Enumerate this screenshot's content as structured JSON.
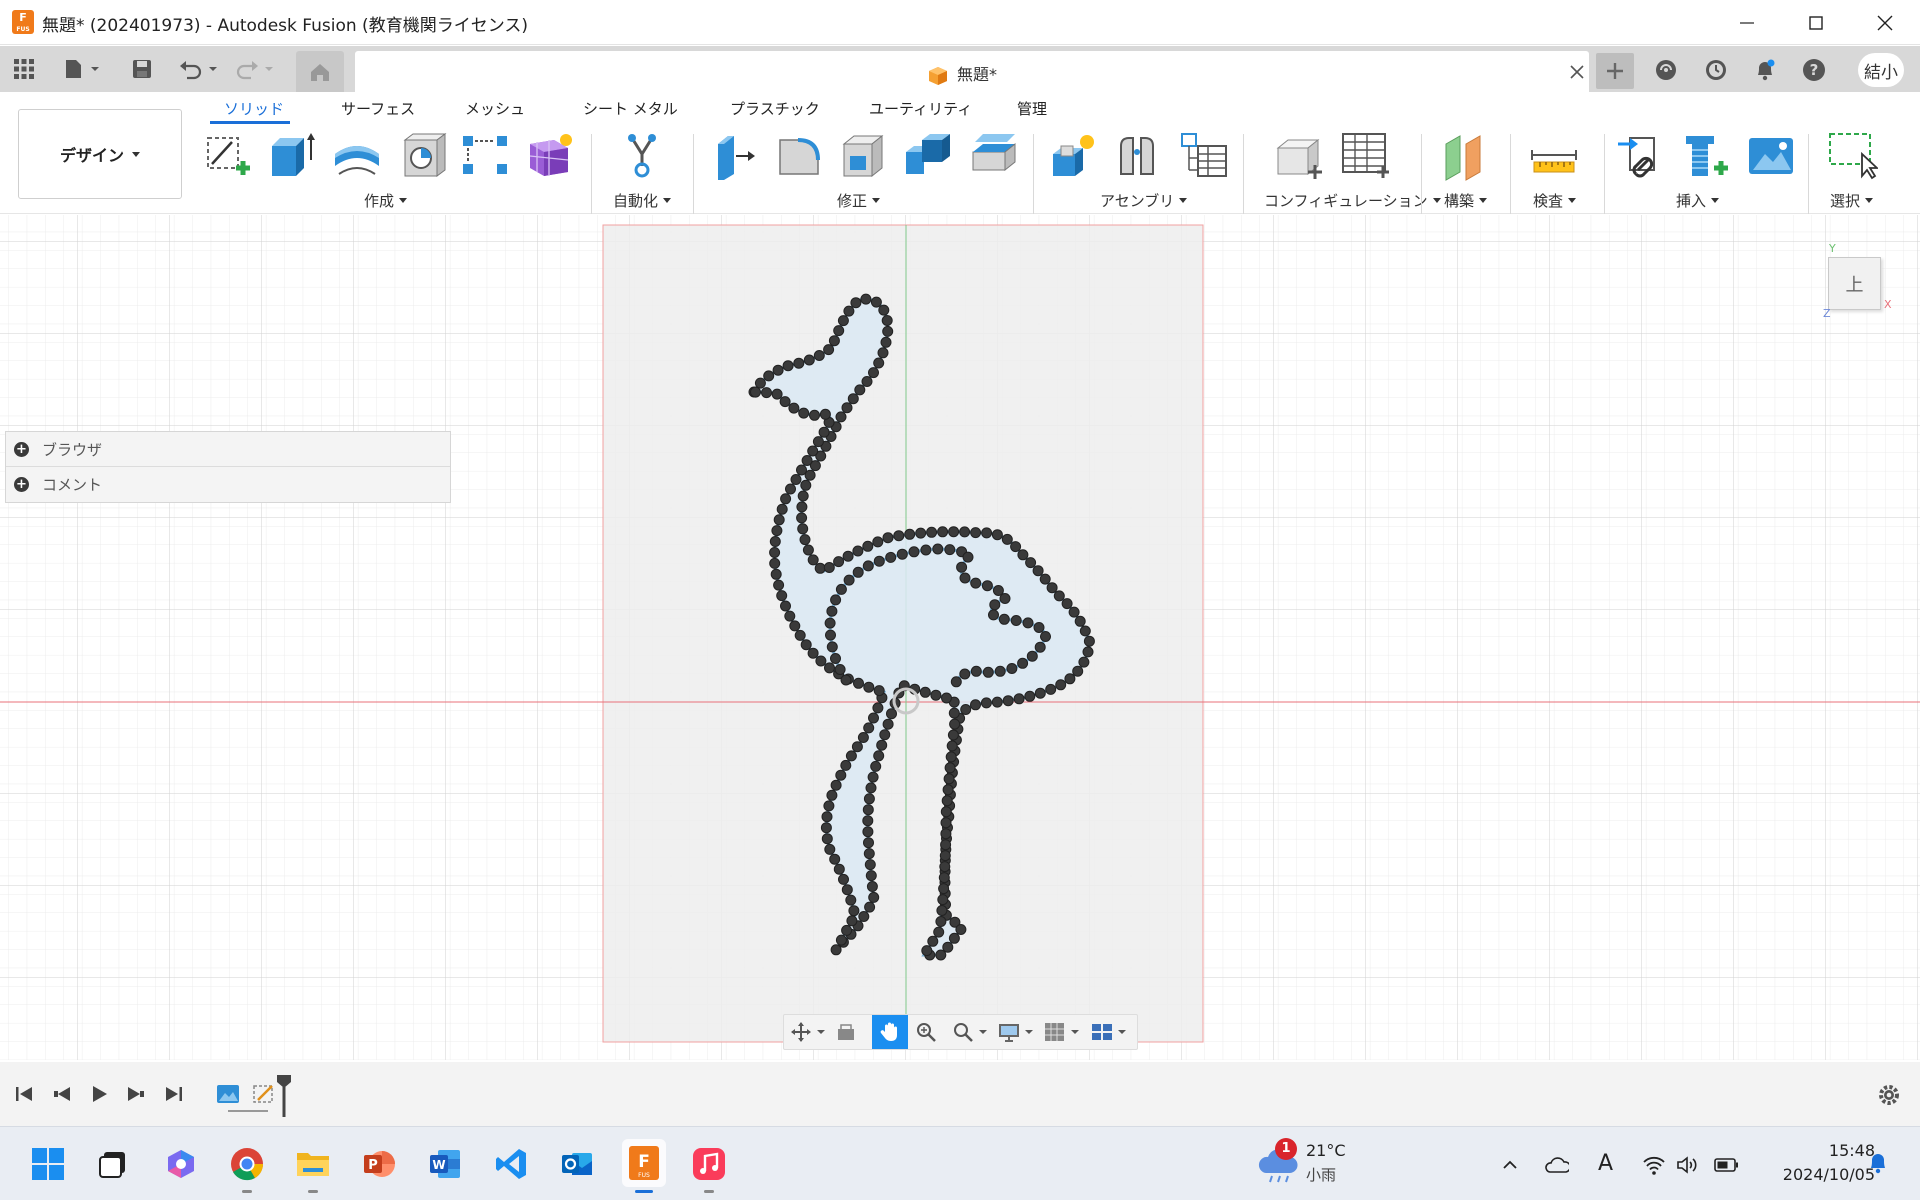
{
  "window": {
    "title": "無題* (202401973) - Autodesk Fusion (教育機関ライセンス)",
    "app_icon_text": "F",
    "app_icon_sub": "FUS"
  },
  "document": {
    "tab_label": "無題*"
  },
  "user": {
    "initials": "結小"
  },
  "workspace": {
    "label": "デザイン"
  },
  "tabs": [
    "ソリッド",
    "サーフェス",
    "メッシュ",
    "シート メタル",
    "プラスチック",
    "ユーティリティ",
    "管理"
  ],
  "active_tab": "ソリッド",
  "tool_groups": [
    {
      "label": "作成"
    },
    {
      "label": "自動化"
    },
    {
      "label": "修正"
    },
    {
      "label": "アセンブリ"
    },
    {
      "label": "コンフィギュレーション"
    },
    {
      "label": "構築"
    },
    {
      "label": "検査"
    },
    {
      "label": "挿入"
    },
    {
      "label": "選択"
    }
  ],
  "browser": {
    "items": [
      {
        "label": "ブラウザ"
      },
      {
        "label": "コメント"
      }
    ]
  },
  "viewcube": {
    "face_label": "上",
    "axis_y": "Y",
    "axis_x": "X",
    "axis_z": "Z"
  },
  "taskbar": {
    "weather": {
      "badge": "1",
      "temp": "21°C",
      "desc": "小雨"
    },
    "clock": {
      "time": "15:48",
      "date": "2024/10/05"
    },
    "input_indicator": "A"
  },
  "colors": {
    "accent": "#1a6fd8",
    "fusion_orange": "#f07a1a",
    "sketch_profile": "#dbe9f3",
    "axis_red": "#e8717a",
    "axis_green": "#7fc98a",
    "canvas_image": "#ededed"
  }
}
